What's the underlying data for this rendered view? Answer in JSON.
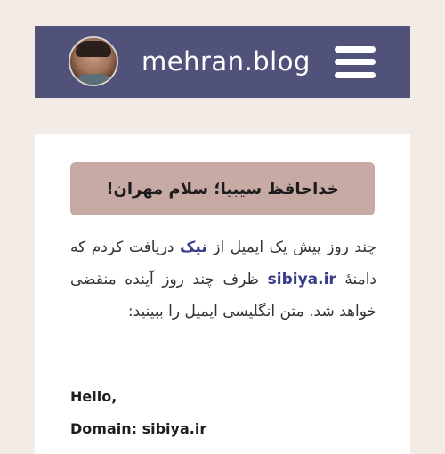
{
  "header": {
    "site_title": "mehran.blog",
    "menu_icon": "hamburger-menu-icon",
    "avatar": "profile-photo"
  },
  "post": {
    "title": "خداحافظ سیبیا؛ سلام مهران!",
    "body": {
      "part1": "چند روز پیش یک ایمیل از ",
      "link_nic": "نیک",
      "part2": " دریافت کردم که دامنهٔ ",
      "link_domain": "sibiya.ir",
      "part3": " ظرف چند روز آینده منقضی خواهد شد. متن انگلیسی ایمیل را ببینید:"
    },
    "email": {
      "greeting": "Hello,",
      "domain_line": "Domain: sibiya.ir"
    }
  },
  "colors": {
    "page_bg": "#f2ebe6",
    "header_bg": "#51527a",
    "title_box_bg": "#c8aaa5",
    "link": "#3a3d8a"
  }
}
